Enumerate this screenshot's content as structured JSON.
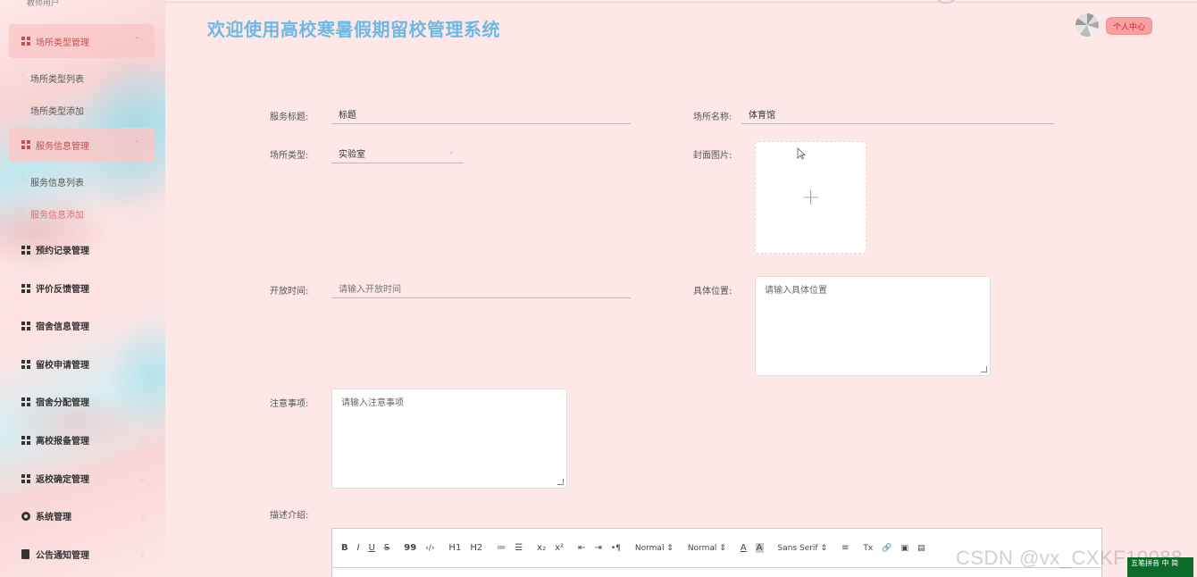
{
  "app": {
    "title": "欢迎使用高校寒暑假期留校管理系统",
    "user_center": "个人中心"
  },
  "sidebar": {
    "faded_top": "教师用户",
    "groups": [
      {
        "label": "场所类型管理",
        "children": [
          "场所类型列表",
          "场所类型添加"
        ]
      },
      {
        "label": "服务信息管理",
        "children": [
          "服务信息列表",
          "服务信息添加"
        ],
        "active_child": "服务信息添加"
      }
    ],
    "items": [
      {
        "label": "预约记录管理"
      },
      {
        "label": "评价反馈管理"
      },
      {
        "label": "宿舍信息管理"
      },
      {
        "label": "留校申请管理"
      },
      {
        "label": "宿舍分配管理"
      },
      {
        "label": "离校报备管理"
      },
      {
        "label": "返校确定管理"
      },
      {
        "label": "系统管理"
      },
      {
        "label": "公告通知管理"
      }
    ]
  },
  "form": {
    "service_title": {
      "label": "服务标题:",
      "value": "标题"
    },
    "venue_name": {
      "label": "场所名称:",
      "value": "体育馆"
    },
    "venue_type": {
      "label": "场所类型:",
      "value": "实验室"
    },
    "cover_image": {
      "label": "封面图片:",
      "upload_symbol": "+"
    },
    "open_time": {
      "label": "开放时间:",
      "placeholder": "请输入开放时间"
    },
    "location": {
      "label": "具体位置:",
      "placeholder": "请输入具体位置"
    },
    "notes": {
      "label": "注意事项:",
      "placeholder": "请输入注意事项"
    },
    "description": {
      "label": "描述介绍:"
    }
  },
  "editor": {
    "toolbar": [
      "B",
      "I",
      "U",
      "S",
      "99",
      "‹/›",
      "H1",
      "H2",
      "≔",
      "☰",
      "x₂",
      "x²",
      "⇤",
      "⇥",
      "•¶",
      "Normal ⇕",
      "Normal ⇕",
      "A",
      "A",
      "Sans Serif ⇕",
      "≡",
      "Tx",
      "🔗",
      "▣",
      "▤"
    ]
  },
  "overlay": {
    "watermark": "CSDN @vx_CXKF10088",
    "ime": "五笔拼音 中 简"
  },
  "colors": {
    "background": "#fde7e7",
    "title": "#6cb9e4",
    "accent": "#f7a0a0"
  }
}
